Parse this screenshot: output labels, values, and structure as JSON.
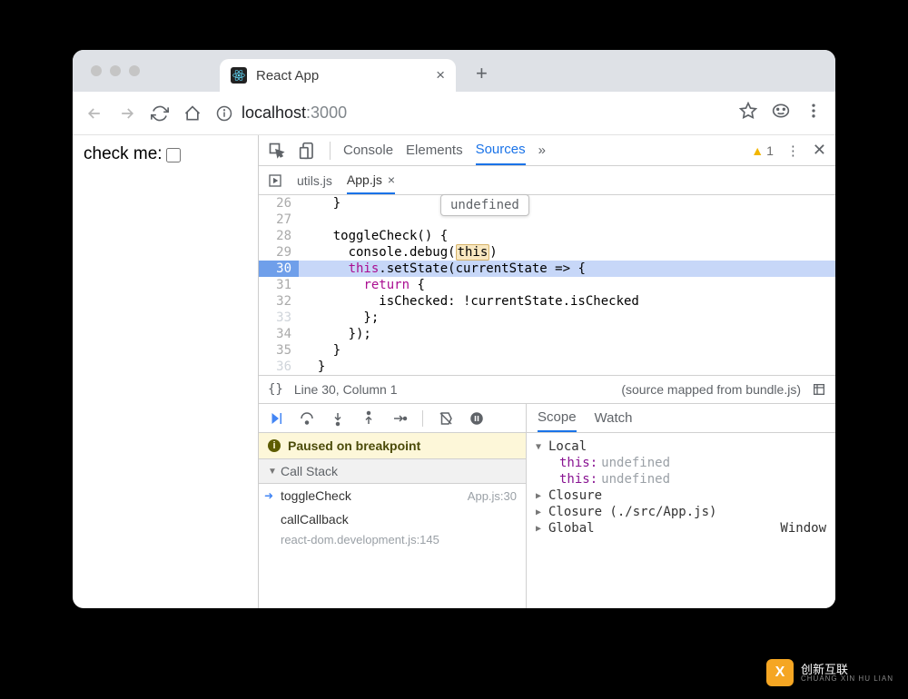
{
  "browser": {
    "tab_title": "React App",
    "url_host": "localhost",
    "url_port": ":3000"
  },
  "page": {
    "label": "check me:"
  },
  "devtools": {
    "tabs": {
      "console": "Console",
      "elements": "Elements",
      "sources": "Sources"
    },
    "warn_count": "1",
    "files": {
      "utils": "utils.js",
      "app": "App.js"
    },
    "tooltip": "undefined",
    "code": {
      "l26": "    }",
      "n26": "26",
      "l27": "",
      "n27": "27",
      "l28": "    toggleCheck() {",
      "n28": "28",
      "l29a": "      console.debug(",
      "l29b": "this",
      "l29c": ")",
      "n29": "29",
      "l30a": "      ",
      "l30b": "this",
      "l30c": ".setState(currentState => {",
      "n30": "30",
      "l31a": "        ",
      "l31b": "return",
      "l31c": " {",
      "n31": "31",
      "l32": "          isChecked: !currentState.isChecked",
      "n32": "32",
      "l33": "        };",
      "n33": "33",
      "l34": "      });",
      "n34": "34",
      "l35": "    }",
      "n35": "35",
      "l36": "  }",
      "n36": "36"
    },
    "status": {
      "braces": "{}",
      "pos": "Line 30, Column 1",
      "mapped": "(source mapped from bundle.js)"
    },
    "paused": "Paused on breakpoint",
    "callstack_header": "Call Stack",
    "stack": [
      {
        "name": "toggleCheck",
        "loc": "App.js:30"
      },
      {
        "name": "callCallback",
        "loc": "react-dom.development.js:145"
      }
    ],
    "scope": {
      "tabs": {
        "scope": "Scope",
        "watch": "Watch"
      },
      "local_label": "Local",
      "this_label": "this:",
      "undefined": "undefined",
      "closure1": "Closure",
      "closure2": "Closure (./src/App.js)",
      "global": "Global",
      "global_val": "Window"
    }
  },
  "watermark": {
    "badge": "X",
    "cn": "创新互联",
    "en": "CHUANG XIN HU LIAN"
  }
}
